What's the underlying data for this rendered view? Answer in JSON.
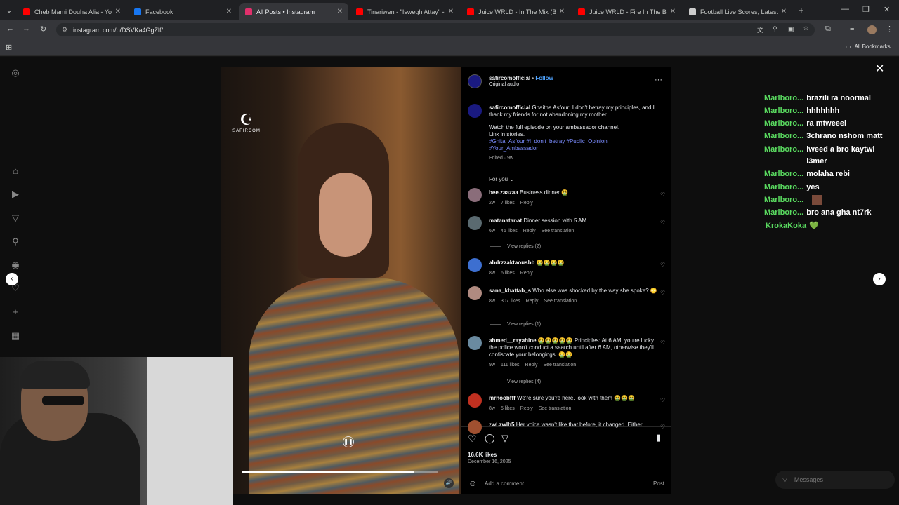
{
  "browser": {
    "tabs": [
      {
        "title": "Cheb Mami Douha Alia - YouTu",
        "color": "#ff0000",
        "active": false
      },
      {
        "title": "Facebook",
        "color": "#1877f2",
        "active": false
      },
      {
        "title": "All Posts • Instagram",
        "color": "#e1306c",
        "active": true
      },
      {
        "title": "Tinariwen - \"Iswegh Attay\" - Yo",
        "color": "#ff0000",
        "active": false
      },
      {
        "title": "Juice WRLD - In The Mix (Be H",
        "color": "#ff0000",
        "active": false
      },
      {
        "title": "Juice WRLD - Fire In The Booth",
        "color": "#ff0000",
        "active": false
      },
      {
        "title": "Football Live Scores, Latest Foo",
        "color": "#cccccc",
        "active": false
      }
    ],
    "url": "instagram.com/p/DSVKa4GgZlf/",
    "bookmarks_label": "All Bookmarks"
  },
  "post": {
    "username": "safircomofficial",
    "follow": "Follow",
    "audio": "Original audio",
    "caption_user": "safircomofficial",
    "caption": "Ghaitha Asfour: I don't betray my principles, and I thank my friends for not abandoning my mother.",
    "caption2": "Watch the full episode on your ambassador channel.",
    "caption3": "Link in stories.",
    "hashtags": "#Ghita_Asfour #I_don't_betray #Public_Opinion #Your_Ambassador",
    "edited": "Edited · 9w",
    "for_you": "For you",
    "watermark": "SAFIRCOM",
    "likes": "16.6K likes",
    "date": "December 16, 2025",
    "add_comment": "Add a comment...",
    "post_btn": "Post",
    "reply": "Reply",
    "see_translation": "See translation"
  },
  "comments": [
    {
      "user": "bee.zaazaa",
      "text": "Business dinner 🤮",
      "time": "2w",
      "likes": "7 likes",
      "translate": false,
      "avatar": "#8a6d7a"
    },
    {
      "user": "matanatanat",
      "text": "Dinner session with 5 AM",
      "time": "6w",
      "likes": "46 likes",
      "translate": true,
      "avatar": "#5a6a70"
    },
    {
      "user": "abdrzzaktaousbb",
      "text": "🤮🤮🤮🤮",
      "time": "8w",
      "likes": "6 likes",
      "translate": false,
      "avatar": "#3d6fd0"
    },
    {
      "user": "sana_khattab_s",
      "text": "Who else was shocked by the way she spoke? 😳",
      "time": "8w",
      "likes": "307 likes",
      "translate": true,
      "avatar": "#b08a80"
    },
    {
      "user": "ahmed__rayahine",
      "text": "🤮🤮🤮🤮🤮 Principles: At 6 AM, you're lucky the police won't conduct a search until after 6 AM, otherwise they'll confiscate your belongings. 🤮🤮",
      "time": "9w",
      "likes": "111 likes",
      "translate": true,
      "avatar": "#6a8aa0"
    },
    {
      "user": "mrnoobfff",
      "text": "We're sure you're here, look with them 🤮🤮🤮",
      "time": "8w",
      "likes": "5 likes",
      "translate": true,
      "avatar": "#c03020"
    },
    {
      "user": "zwl.zwlh5",
      "text": "Her voice wasn't like that before, it changed. Either",
      "time": "",
      "likes": "",
      "translate": false,
      "avatar": "#a05030"
    }
  ],
  "view_replies": [
    "View replies (2)",
    "View replies (1)",
    "View replies (4)"
  ],
  "chat": [
    {
      "name": "Marlboro...",
      "text": "brazili ra noormal"
    },
    {
      "name": "Marlboro...",
      "text": "hhhhhhh"
    },
    {
      "name": "Marlboro...",
      "text": "ra mtweeel"
    },
    {
      "name": "Marlboro...",
      "text": "3chrano nshom matt"
    },
    {
      "name": "Marlboro...",
      "text": "lweed a bro kaytwl"
    },
    {
      "name": "",
      "text": "l3mer"
    },
    {
      "name": "Marlboro...",
      "text": "molaha rebi"
    },
    {
      "name": "Marlboro...",
      "text": "yes"
    },
    {
      "name": "Marlboro...",
      "text": ""
    },
    {
      "name": "Marlboro...",
      "text": "bro ana gha nt7rk"
    },
    {
      "name": "KrokaKoka",
      "text": "💚"
    }
  ],
  "messages_label": "Messages"
}
